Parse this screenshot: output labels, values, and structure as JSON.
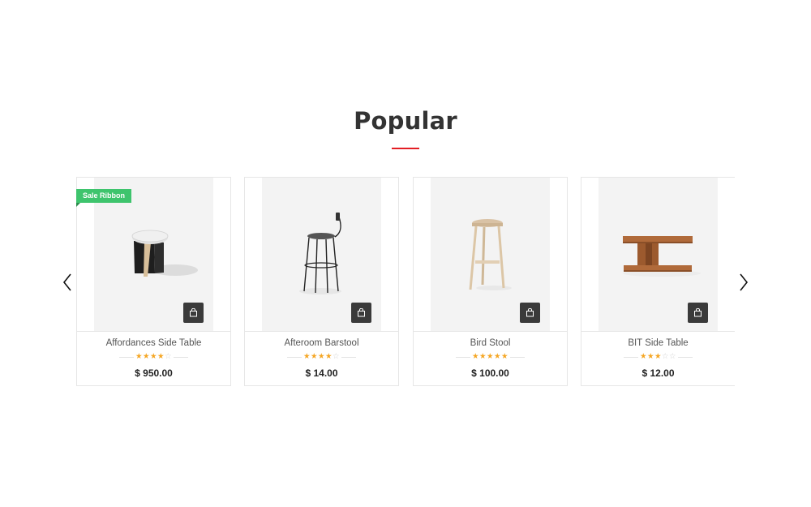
{
  "section": {
    "title": "Popular"
  },
  "products": [
    {
      "name": "Affordances Side Table",
      "price": "$ 950.00",
      "rating": 4,
      "max_rating": 5,
      "badge": "Sale Ribbon",
      "image_icon": "side-table-image"
    },
    {
      "name": "Afteroom Barstool",
      "price": "$ 14.00",
      "rating": 4,
      "max_rating": 5,
      "badge": "",
      "image_icon": "barstool-image"
    },
    {
      "name": "Bird Stool",
      "price": "$ 100.00",
      "rating": 5,
      "max_rating": 5,
      "badge": "",
      "image_icon": "wooden-stool-image"
    },
    {
      "name": "BIT Side Table",
      "price": "$ 12.00",
      "rating": 3,
      "max_rating": 5,
      "badge": "",
      "image_icon": "bit-table-image"
    }
  ],
  "icons": {
    "cart": "shopping-bag-icon",
    "prev": "chevron-left-icon",
    "next": "chevron-right-icon"
  },
  "colors": {
    "accent": "#e31e24",
    "ribbon": "#3ec46d",
    "star": "#f5a623",
    "cart_button": "#3a3a3a"
  }
}
